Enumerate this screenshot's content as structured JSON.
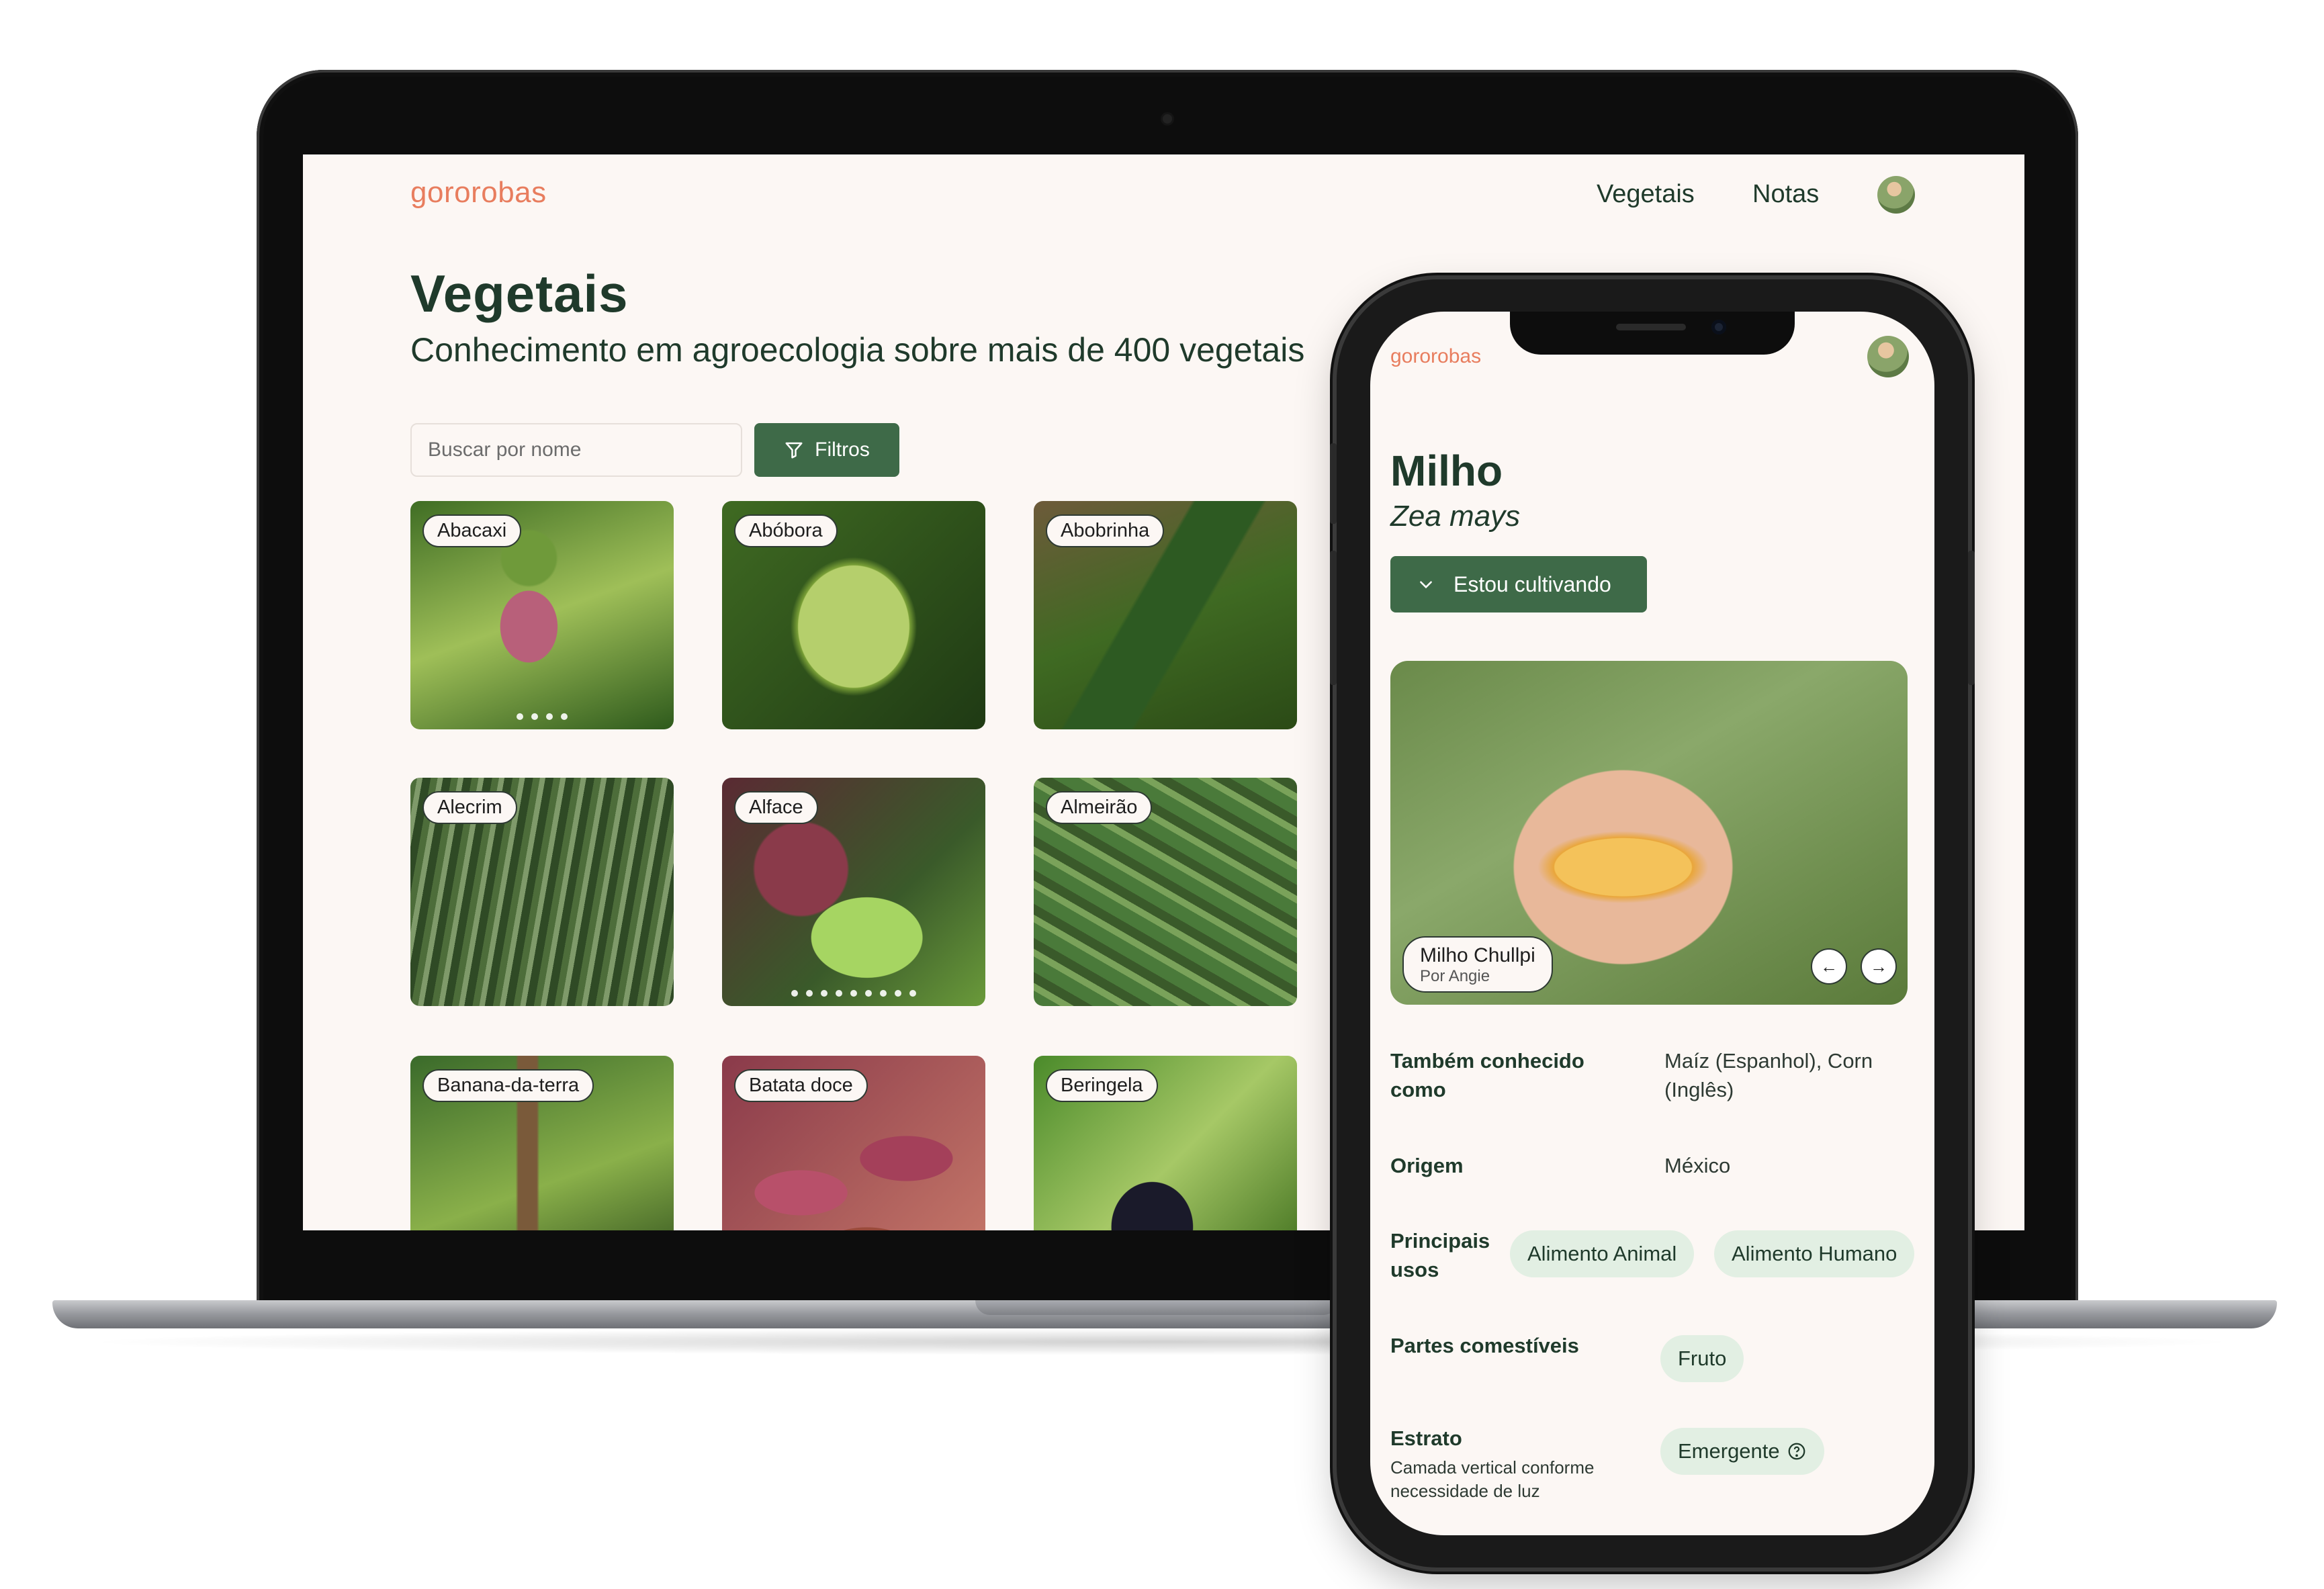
{
  "desktop": {
    "brand": "gororobas",
    "nav": [
      "Vegetais",
      "Notas"
    ],
    "title": "Vegetais",
    "subtitle": "Conhecimento em agroecologia sobre mais de 400 vegetais",
    "search_placeholder": "Buscar por nome",
    "filter_label": "Filtros",
    "cards": [
      "Abacaxi",
      "Abóbora",
      "Abobrinha",
      "Alecrim",
      "Alface",
      "Almeirão",
      "Banana-da-terra",
      "Batata doce",
      "Beringela"
    ]
  },
  "mobile": {
    "brand": "gororobas",
    "title": "Milho",
    "scientific_name": "Zea mays",
    "cultivating_label": "Estou cultivando",
    "photo": {
      "caption": "Milho Chullpi",
      "credit": "Por Angie"
    },
    "also_known_label": "Também conhecido como",
    "also_known_value": "Maíz (Espanhol), Corn (Inglês)",
    "origin_label": "Origem",
    "origin_value": "México",
    "uses_label": "Principais usos",
    "uses": [
      "Alimento Animal",
      "Alimento Humano"
    ],
    "edible_label": "Partes comestíveis",
    "edible_parts": [
      "Fruto"
    ],
    "stratum_label": "Estrato",
    "stratum_note": "Camada vertical conforme necessidade de luz",
    "stratum_value": "Emergente"
  },
  "colors": {
    "brand": "#e87d5e",
    "primary": "#3e6a48",
    "text": "#1f3a2b",
    "background": "#fcf7f4",
    "chip": "#e2efe3"
  }
}
